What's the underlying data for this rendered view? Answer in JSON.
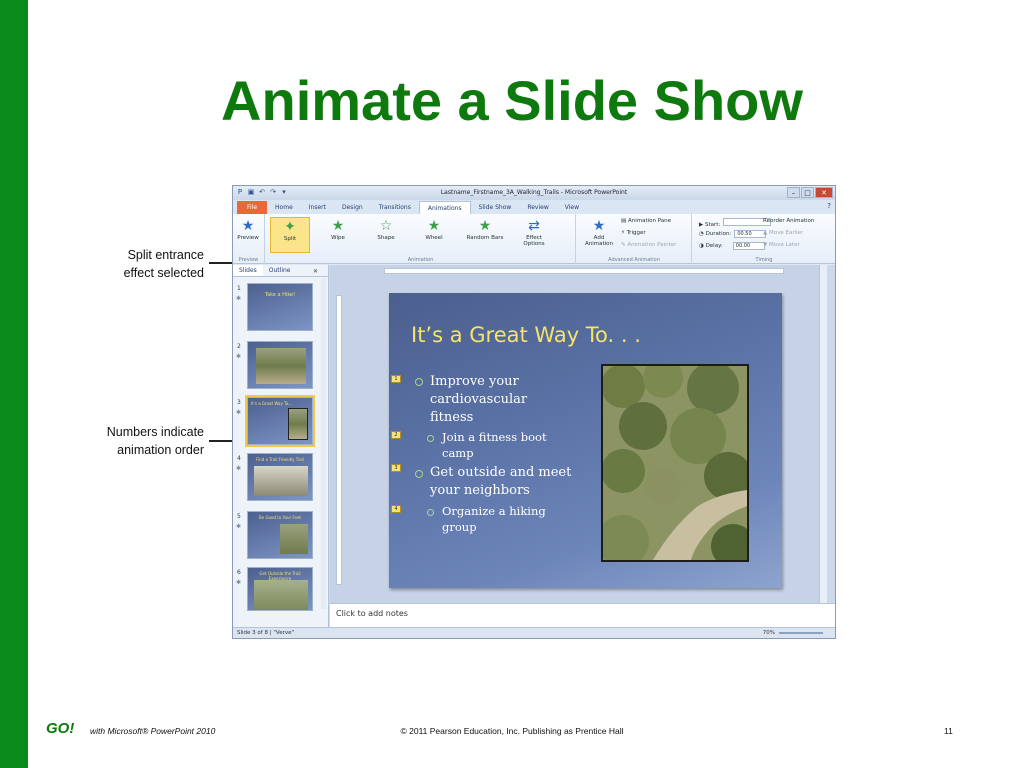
{
  "title": "Animate a Slide Show",
  "window": {
    "title": "Lastname_Firstname_3A_Walking_Trails - Microsoft PowerPoint",
    "controls": [
      "–",
      "□",
      "✕"
    ]
  },
  "tabs": [
    "File",
    "Home",
    "Insert",
    "Design",
    "Transitions",
    "Animations",
    "Slide Show",
    "Review",
    "View"
  ],
  "ribbon": {
    "preview_label": "Preview",
    "effects": [
      "Split",
      "Wipe",
      "Shape",
      "Wheel",
      "Random Bars"
    ],
    "effect_options": "Effect Options",
    "add_animation": "Add Animation",
    "animation_pane": "Animation Pane",
    "trigger": "Trigger",
    "animation_painter": "Animation Painter",
    "start_label": "Start:",
    "duration_label": "Duration:",
    "duration_value": "00.50",
    "delay_label": "Delay:",
    "delay_value": "00.00",
    "reorder_label": "Reorder Animation",
    "move_earlier": "Move Earlier",
    "move_later": "Move Later",
    "group_labels": [
      "Preview",
      "Animation",
      "Advanced Animation",
      "Timing"
    ]
  },
  "panes": {
    "slides_tab": "Slides",
    "outline_tab": "Outline"
  },
  "thumbnails": [
    {
      "num": "1",
      "title": "Take a Hike!"
    },
    {
      "num": "2",
      "title": ""
    },
    {
      "num": "3",
      "title": "It's a Great Way To..."
    },
    {
      "num": "4",
      "title": "Find a Trail Friendly Trail"
    },
    {
      "num": "5",
      "title": "Be Good to Your Feet"
    },
    {
      "num": "6",
      "title": "Get Outside the Trail Experience"
    }
  ],
  "slide": {
    "heading": "It’s a Great Way To. . .",
    "bullets": [
      {
        "text": "Improve your cardiovascular fitness",
        "level": 1,
        "anim": "1"
      },
      {
        "text": "Join a fitness boot camp",
        "level": 2,
        "anim": "2"
      },
      {
        "text": "Get outside and meet your neighbors",
        "level": 1,
        "anim": "3"
      },
      {
        "text": "Organize a hiking group",
        "level": 2,
        "anim": "4"
      }
    ]
  },
  "notes_placeholder": "Click to add notes",
  "status": {
    "slide_info": "Slide 3 of 8",
    "theme": "\"Verve\"",
    "zoom": "70%"
  },
  "callouts": {
    "split": "Split entrance effect selected",
    "numbers": "Numbers indicate animation order"
  },
  "footer": {
    "logo": "GO!",
    "with": "with Microsoft® PowerPoint 2010",
    "copyright": "© 2011 Pearson Education, Inc. Publishing as Prentice Hall",
    "page": "11"
  },
  "colors": {
    "brand_green": "#0e7a0e",
    "selected_effect": "#fbe58b",
    "file_tab": "#e8683a"
  }
}
